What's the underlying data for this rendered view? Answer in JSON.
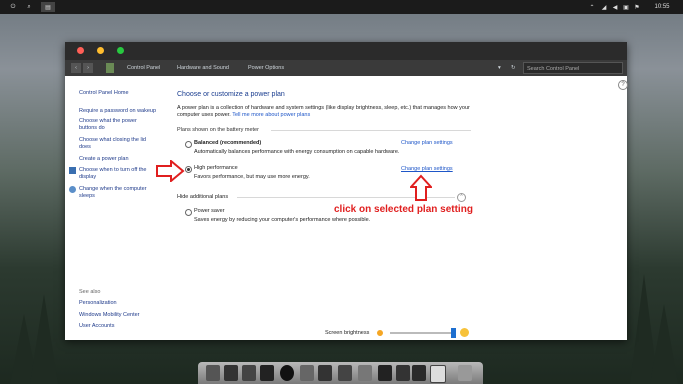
{
  "topbar": {
    "clock": "10:55"
  },
  "address": {
    "crumbs": [
      "Control Panel",
      "Hardware and Sound",
      "Power Options"
    ],
    "search_placeholder": "Search Control Panel"
  },
  "sidebar": {
    "home": "Control Panel Home",
    "items": [
      "Require a password on wakeup",
      "Choose what the power buttons do",
      "Choose what closing the lid does",
      "Create a power plan",
      "Choose when to turn off the display",
      "Change when the computer sleeps"
    ],
    "see_also_header": "See also",
    "see_also": [
      "Personalization",
      "Windows Mobility Center",
      "User Accounts"
    ]
  },
  "main": {
    "title": "Choose or customize a power plan",
    "intro": "A power plan is a collection of hardware and system settings (like display brightness, sleep, etc.) that manages how your computer uses power.",
    "intro_link": "Tell me more about power plans",
    "group_label": "Plans shown on the battery meter",
    "plans": [
      {
        "name": "Balanced (recommended)",
        "desc": "Automatically balances performance with energy consumption on capable hardware.",
        "link": "Change plan settings",
        "selected": false
      },
      {
        "name": "High performance",
        "desc": "Favors performance, but may use more energy.",
        "link": "Change plan settings",
        "selected": true
      }
    ],
    "hide_label": "Hide additional plans",
    "extra_plans": [
      {
        "name": "Power saver",
        "desc": "Saves energy by reducing your computer's performance where possible."
      }
    ],
    "brightness_label": "Screen brightness",
    "brightness_level": 0.95
  },
  "annotation": {
    "text": "click on selected plan setting",
    "color": "#e01f1f"
  }
}
